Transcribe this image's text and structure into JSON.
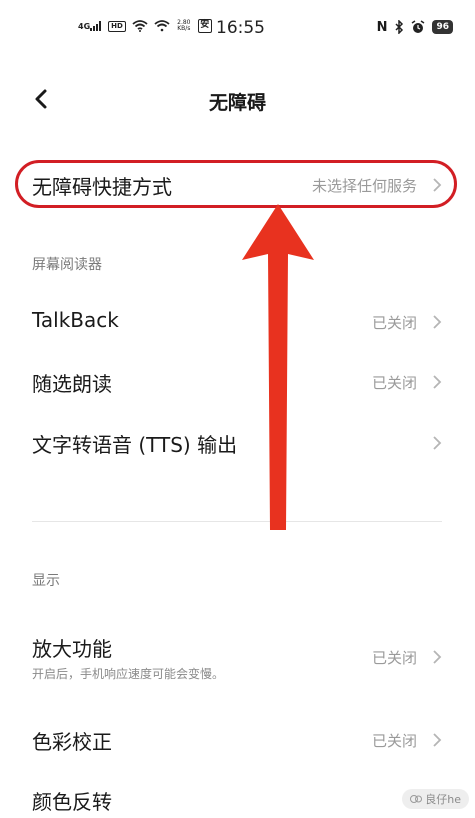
{
  "status_bar": {
    "signal": "4G",
    "hd": "HD",
    "speed_value": "2.80",
    "speed_unit": "KB/s",
    "extra_icon": "安",
    "time": "16:55",
    "nfc": "N",
    "battery": "96"
  },
  "header": {
    "title": "无障碍"
  },
  "shortcut": {
    "label": "无障碍快捷方式",
    "value": "未选择任何服务"
  },
  "sections": {
    "screen_reader": "屏幕阅读器",
    "display": "显示"
  },
  "screen_reader_items": [
    {
      "label": "TalkBack",
      "value": "已关闭"
    },
    {
      "label": "随选朗读",
      "value": "已关闭"
    },
    {
      "label": "文字转语音 (TTS) 输出",
      "value": ""
    }
  ],
  "display_items": [
    {
      "label": "放大功能",
      "sub": "开启后，手机响应速度可能会变慢。",
      "value": "已关闭"
    },
    {
      "label": "色彩校正",
      "value": "已关闭"
    },
    {
      "label": "颜色反转",
      "value": ""
    }
  ],
  "watermark": {
    "text": "良仔he"
  },
  "colors": {
    "annotation_red": "#d21e24",
    "arrow_red": "#e8321f"
  }
}
